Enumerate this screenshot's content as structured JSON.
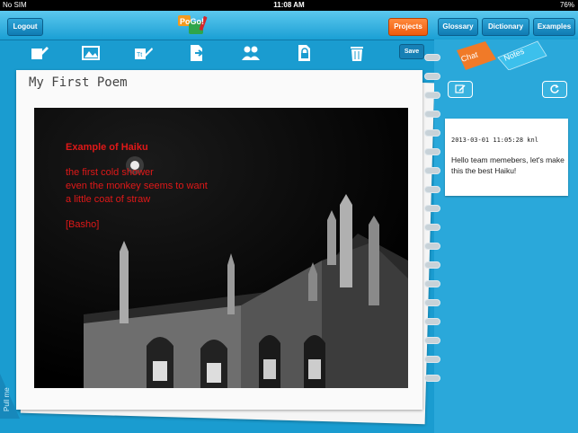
{
  "status_bar": {
    "carrier": "No SIM",
    "time": "11:08 AM",
    "battery": "76%"
  },
  "top_bar": {
    "logout_label": "Logout",
    "logo_text": "PoGo!",
    "projects_label": "Projects",
    "glossary_label": "Glossary",
    "dictionary_label": "Dictionary",
    "examples_label": "Examples"
  },
  "toolbar": {
    "tools": [
      "new-document-icon",
      "image-icon",
      "text-icon",
      "export-icon",
      "users-icon",
      "lock-document-icon",
      "trash-icon"
    ],
    "save_label": "Save"
  },
  "document": {
    "title": "My First Poem",
    "poem_title": "Example of Haiku",
    "lines": [
      "the first cold shower",
      "even the monkey seems to want",
      "a little coat of straw"
    ],
    "attribution": "[Basho]"
  },
  "side_panel": {
    "chat_tab": "Chat",
    "notes_tab": "Notes",
    "pull_label": "Pull me",
    "note": {
      "timestamp": "2013-03-01 11:05:28 knl",
      "text": "Hello team memebers, let's make this the best Haiku!"
    }
  },
  "colors": {
    "accent": "#f05b0d",
    "background": "#1a9cd0",
    "poem_text": "#e01818"
  }
}
